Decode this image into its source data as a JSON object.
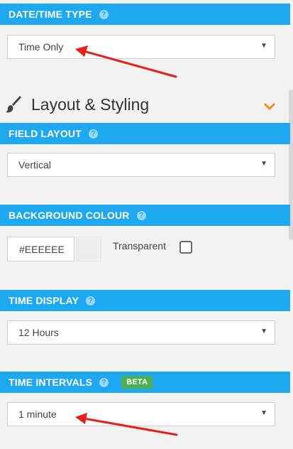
{
  "date_time_type": {
    "header": "DATE/TIME TYPE",
    "help": "?",
    "value": "Time Only"
  },
  "layout_section": {
    "title": "Layout & Styling"
  },
  "field_layout": {
    "header": "FIELD LAYOUT",
    "help": "?",
    "value": "Vertical"
  },
  "background_colour": {
    "header": "BACKGROUND COLOUR",
    "help": "?",
    "value": "#EEEEEE",
    "swatch_color": "#eeeeee",
    "transparent_label": "Transparent"
  },
  "time_display": {
    "header": "TIME DISPLAY",
    "help": "?",
    "value": "12 Hours"
  },
  "time_intervals": {
    "header": "TIME INTERVALS",
    "help": "?",
    "badge": "BETA",
    "value": "1 minute"
  },
  "colors": {
    "header_bar": "#1da8f0",
    "accent_chevron": "#f08a24",
    "annotation_arrow": "#e8201a",
    "beta_badge": "#4caf50"
  },
  "icons": {
    "dropdown": "caret-down-icon",
    "section": "paintbrush-icon",
    "collapse": "chevron-down-icon"
  }
}
